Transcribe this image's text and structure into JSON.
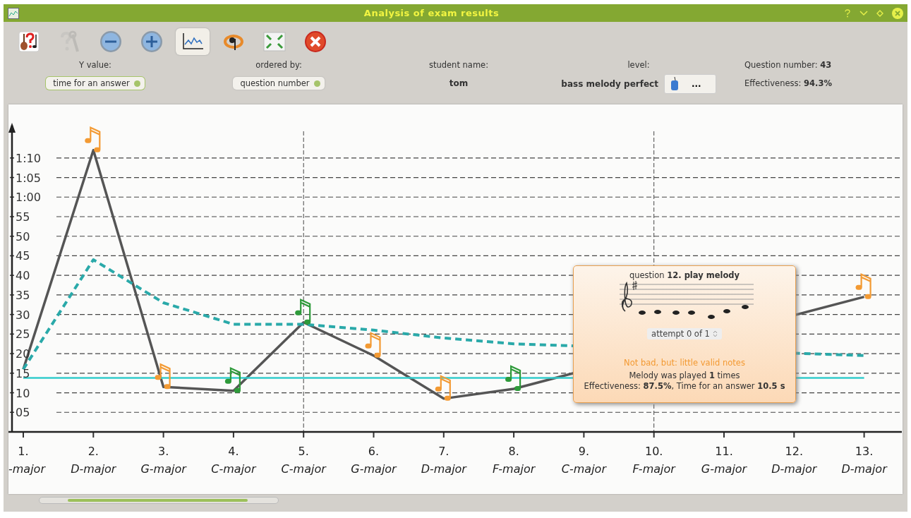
{
  "window": {
    "title": "Analysis of exam results"
  },
  "toolbar": [
    {
      "kind": "exam",
      "selected": false
    },
    {
      "kind": "settings",
      "selected": false
    },
    {
      "kind": "zoom-out",
      "selected": false
    },
    {
      "kind": "zoom-in",
      "selected": false
    },
    {
      "kind": "chart",
      "selected": true
    },
    {
      "kind": "help",
      "selected": false
    },
    {
      "kind": "fullscreen",
      "selected": false
    },
    {
      "kind": "close",
      "selected": false
    }
  ],
  "controls": {
    "y_value": {
      "label": "Y value:",
      "value": "time for an answer"
    },
    "ordered_by": {
      "label": "ordered by:",
      "value": "question number"
    },
    "student": {
      "label": "student name:",
      "value": "tom"
    },
    "level": {
      "label": "level:",
      "value": "bass melody perfect",
      "button": "..."
    },
    "question_number": {
      "label": "Question number:",
      "value": "43"
    },
    "effectiveness": {
      "label": "Effectiveness:",
      "value": "94.3%"
    }
  },
  "chart": {
    "chart_data": {
      "type": "line",
      "grid": true,
      "categories": [
        "1.",
        "2.",
        "3.",
        "4.",
        "5.",
        "6.",
        "7.",
        "8.",
        "9.",
        "10.",
        "11.",
        "12.",
        "13."
      ],
      "ylim": [
        0,
        77
      ],
      "yticks": [
        {
          "value": 5,
          "label": "05"
        },
        10,
        15,
        20,
        25,
        30,
        35,
        40,
        45,
        50,
        55,
        {
          "value": 60,
          "label": "1:00"
        },
        {
          "value": 65,
          "label": "1:05"
        },
        {
          "value": 70,
          "label": "1:10"
        }
      ],
      "series": [
        {
          "color": "#555555",
          "line_style": "solid",
          "values": [
            16,
            72,
            11.5,
            10.5,
            28,
            19.5,
            8.5,
            11,
            null,
            null,
            null,
            null,
            34.5
          ]
        },
        {
          "color": "#2aa9a9",
          "line_style": "dashed",
          "values": [
            16,
            44,
            33,
            27.5,
            27.5,
            26,
            24,
            22.5,
            null,
            null,
            null,
            null,
            19.5
          ]
        },
        {
          "color": "#33cccc",
          "line_style": "solid",
          "values": [
            13.8,
            13.8,
            13.8,
            13.8,
            13.8,
            13.8,
            13.8,
            13.8,
            null,
            null,
            null,
            null,
            13.8
          ]
        }
      ]
    },
    "questions": [
      {
        "key": "-major"
      },
      {
        "key": "D-major",
        "color": "#f39a33"
      },
      {
        "key": "G-major",
        "color": "#f39a33"
      },
      {
        "key": "C-major",
        "color": "#2e9a3a"
      },
      {
        "key": "C-major",
        "color": "#2e9a3a"
      },
      {
        "key": "G-major",
        "color": "#f39a33"
      },
      {
        "key": "D-major",
        "color": "#f39a33"
      },
      {
        "key": "F-major",
        "color": "#2e9a3a"
      },
      {
        "key": "C-major"
      },
      {
        "key": "F-major"
      },
      {
        "key": "G-major"
      },
      {
        "key": "D-major"
      },
      {
        "key": "D-major",
        "color": "#f39a33"
      }
    ]
  },
  "tooltip": {
    "title": "question **12. play melody**",
    "attempt": "attempt 0 of 1",
    "verdict": "Not bad, but: little valid notes",
    "played": "Melody was played **1** times",
    "result": "Effectiveness: **87.5%**, Time for an answer **10.5 s**"
  }
}
